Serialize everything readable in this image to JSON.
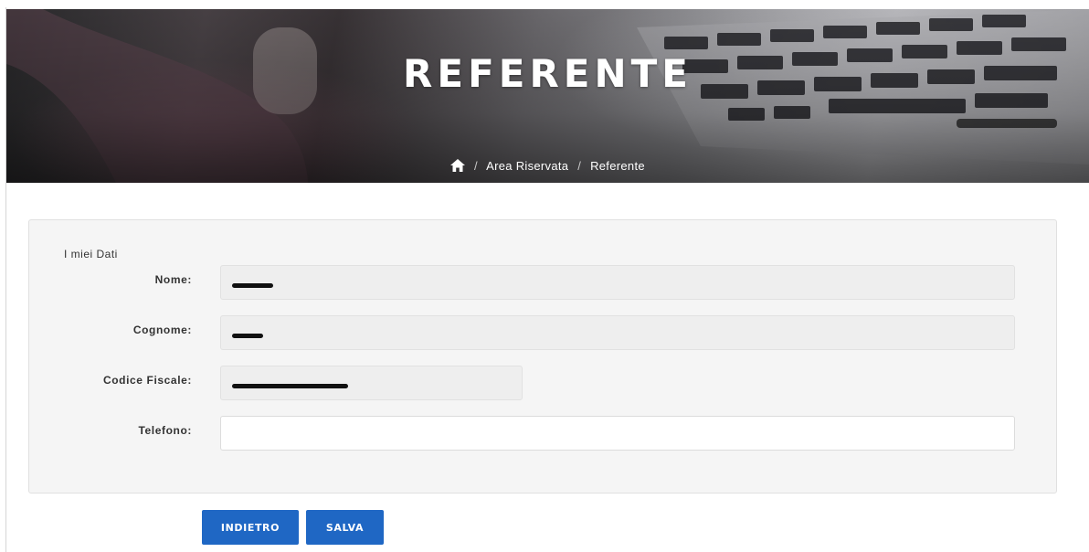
{
  "hero": {
    "title": "REFERENTE"
  },
  "breadcrumb": {
    "home_icon": "home-icon",
    "separator": "/",
    "items": [
      {
        "label": "Area Riservata"
      },
      {
        "label": "Referente"
      }
    ]
  },
  "form": {
    "section_title": "I miei Dati",
    "fields": [
      {
        "label": "Nome:",
        "value": "",
        "redacted": true,
        "readonly": true
      },
      {
        "label": "Cognome:",
        "value": "",
        "redacted": true,
        "readonly": true
      },
      {
        "label": "Codice Fiscale:",
        "value": "",
        "redacted": true,
        "readonly": true
      },
      {
        "label": "Telefono:",
        "value": "",
        "redacted": false,
        "readonly": false
      }
    ]
  },
  "buttons": {
    "back_label": "INDIETRO",
    "save_label": "SALVA"
  },
  "colors": {
    "primary_button": "#1f67c4",
    "panel_background": "#f5f5f5",
    "readonly_input": "#eeeeee"
  }
}
